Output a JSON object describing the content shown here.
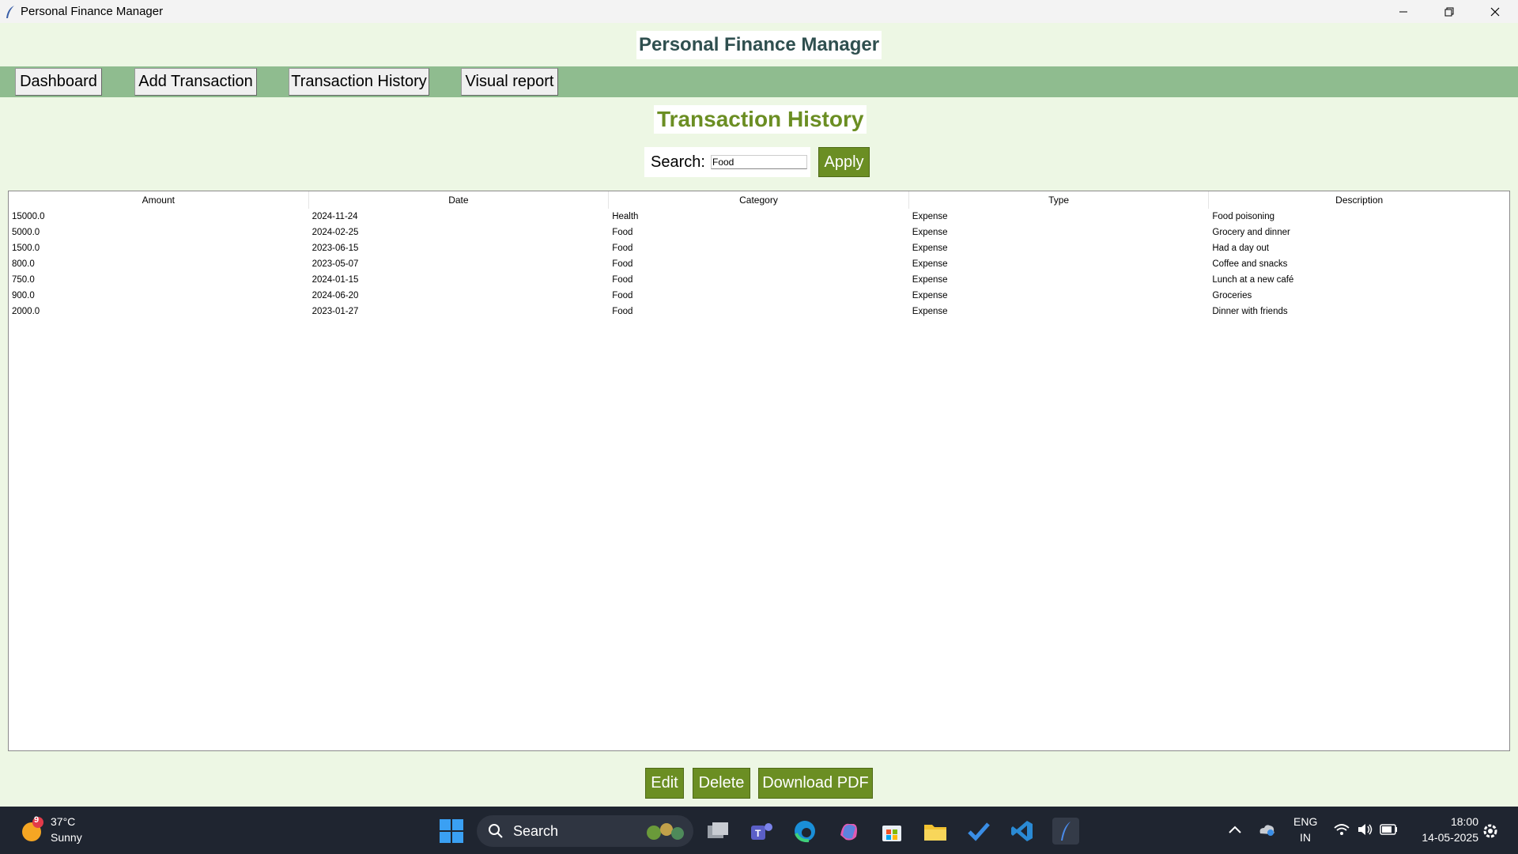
{
  "window": {
    "title": "Personal Finance Manager",
    "controls": [
      "minimize-icon",
      "maximize-icon",
      "close-icon"
    ]
  },
  "app": {
    "title": "Personal Finance Manager"
  },
  "nav": {
    "items": [
      {
        "label": "Dashboard"
      },
      {
        "label": "Add Transaction"
      },
      {
        "label": "Transaction History"
      },
      {
        "label": "Visual report"
      }
    ]
  },
  "page": {
    "title": "Transaction History",
    "search_label": "Search:",
    "search_value": "Food",
    "apply_label": "Apply"
  },
  "table": {
    "columns": [
      "Amount",
      "Date",
      "Category",
      "Type",
      "Description"
    ],
    "rows": [
      [
        "15000.0",
        "2024-11-24",
        "Health",
        "Expense",
        "Food poisoning"
      ],
      [
        "5000.0",
        "2024-02-25",
        "Food",
        "Expense",
        "Grocery and dinner"
      ],
      [
        "1500.0",
        "2023-06-15",
        "Food",
        "Expense",
        "Had a day out"
      ],
      [
        "800.0",
        "2023-05-07",
        "Food",
        "Expense",
        "Coffee and snacks"
      ],
      [
        "750.0",
        "2024-01-15",
        "Food",
        "Expense",
        "Lunch at a new café"
      ],
      [
        "900.0",
        "2024-06-20",
        "Food",
        "Expense",
        "Groceries"
      ],
      [
        "2000.0",
        "2023-01-27",
        "Food",
        "Expense",
        "Dinner with friends"
      ]
    ]
  },
  "actions": {
    "edit_label": "Edit",
    "delete_label": "Delete",
    "download_label": "Download PDF"
  },
  "taskbar": {
    "weather_badge": "9",
    "weather_temp": "37°C",
    "weather_condition": "Sunny",
    "search_label": "Search",
    "lang_top": "ENG",
    "lang_bottom": "IN",
    "time": "18:00",
    "date": "14-05-2025"
  },
  "colors": {
    "background": "#edf7e4",
    "navbar": "#8fbc8f",
    "accent_green": "#6b8e23",
    "app_title": "#2f4f4f"
  }
}
